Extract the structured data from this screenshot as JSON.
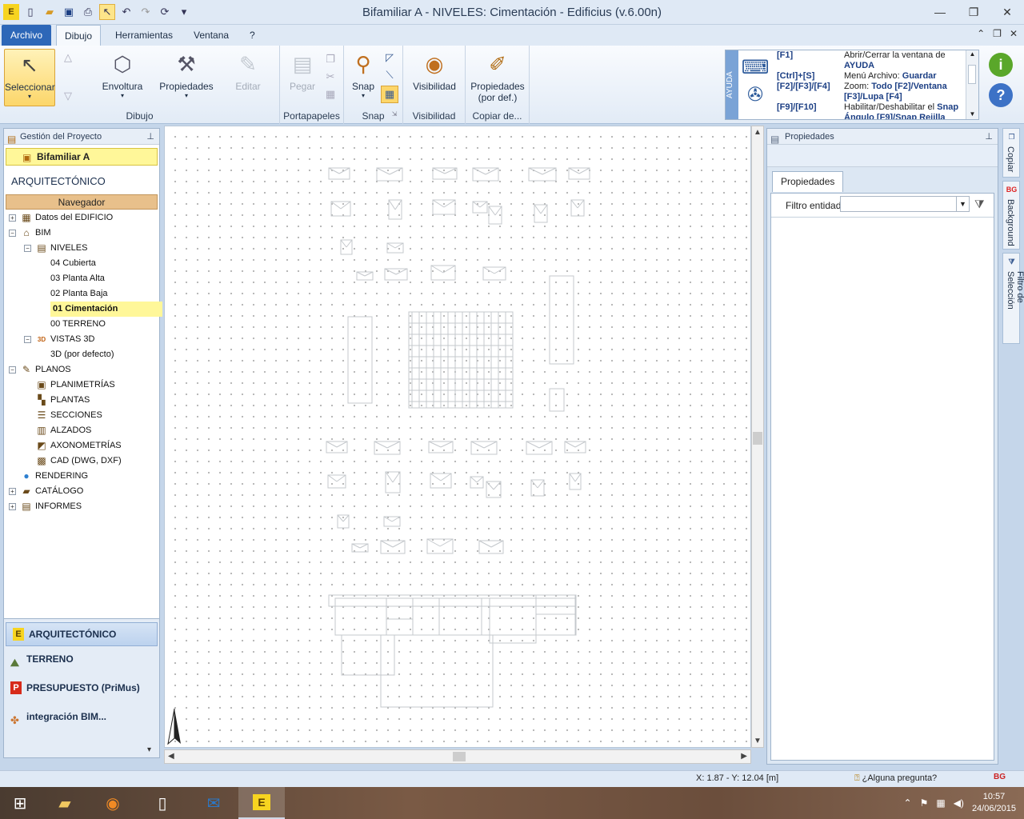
{
  "window": {
    "title": "Bifamiliar A -  NIVELES: Cimentación - Edificius (v.6.00n)"
  },
  "menu": {
    "tabs": [
      "Archivo",
      "Dibujo",
      "Herramientas",
      "Ventana",
      "?"
    ]
  },
  "ribbon": {
    "seleccionar": "Seleccionar",
    "envoltura": "Envoltura",
    "propiedades": "Propiedades",
    "editar": "Editar",
    "pegar": "Pegar",
    "snap": "Snap",
    "visibilidad": "Visibilidad",
    "propiedades_def_1": "Propiedades",
    "propiedades_def_2": "(por def.)",
    "groups": {
      "dibujo": "Dibujo",
      "portapapeles": "Portapapeles",
      "snap": "Snap",
      "visibilidad": "Visibilidad",
      "copiar": "Copiar de..."
    }
  },
  "help": {
    "label": "AYUDA",
    "rows": [
      {
        "key": "[F1]",
        "text": "Abrir/Cerrar la ventana de",
        "bold": "AYUDA"
      },
      {
        "key": "[Ctrl]+[S]",
        "text": "Menú Archivo:",
        "bold": "Guardar"
      },
      {
        "key": "[F2]/[F3]/[F4]",
        "text": "Zoom:",
        "bold": "Todo [F2]/Ventana [F3]/Lupa [F4]"
      },
      {
        "key": "[F9]/[F10]",
        "text": "Habilitar/Deshabilitar el",
        "bold": "Snap Ángulo [F9]/Snap Rejilla"
      }
    ]
  },
  "left_panel": {
    "header": "Gestión del Proyecto",
    "project": "Bifamiliar A",
    "section_title": "ARQUITECTÓNICO",
    "navigator": "Navegador",
    "tree": [
      {
        "label": "Datos del EDIFICIO",
        "level": 0,
        "exp": "+",
        "icon": "▦"
      },
      {
        "label": "BIM",
        "level": 0,
        "exp": "−",
        "icon": "⌂"
      },
      {
        "label": "NIVELES",
        "level": 1,
        "exp": "−",
        "icon": "▤"
      },
      {
        "label": "04 Cubierta",
        "level": 2
      },
      {
        "label": "03 Planta Alta",
        "level": 2
      },
      {
        "label": "02 Planta Baja",
        "level": 2
      },
      {
        "label": "01 Cimentación",
        "level": 2,
        "current": true
      },
      {
        "label": "00 TERRENO",
        "level": 2
      },
      {
        "label": "VISTAS 3D",
        "level": 1,
        "exp": "−",
        "icon": "3D"
      },
      {
        "label": "3D (por defecto)",
        "level": 2
      },
      {
        "label": "PLANOS",
        "level": 0,
        "exp": "−",
        "icon": "✎"
      },
      {
        "label": "PLANIMETRÍAS",
        "level": 1,
        "icon": "▣"
      },
      {
        "label": "PLANTAS",
        "level": 1,
        "icon": "▚"
      },
      {
        "label": "SECCIONES",
        "level": 1,
        "icon": "☰"
      },
      {
        "label": "ALZADOS",
        "level": 1,
        "icon": "▥"
      },
      {
        "label": "AXONOMETRÍAS",
        "level": 1,
        "icon": "◩"
      },
      {
        "label": "CAD (DWG, DXF)",
        "level": 1,
        "icon": "▩"
      },
      {
        "label": "RENDERING",
        "level": 0,
        "icon": "●"
      },
      {
        "label": "CATÁLOGO",
        "level": 0,
        "exp": "+",
        "icon": "▰"
      },
      {
        "label": "INFORMES",
        "level": 0,
        "exp": "+",
        "icon": "▤"
      }
    ],
    "modules": [
      "ARQUITECTÓNICO",
      "TERRENO",
      "PRESUPUESTO (PriMus)",
      "integración BIM..."
    ]
  },
  "right_panel": {
    "header": "Propiedades",
    "tab": "Propiedades",
    "filter_label": "Filtro entidad",
    "filter_value": ""
  },
  "side_tabs": [
    "Copiar",
    "Background",
    "Filtro de Selección"
  ],
  "status": {
    "coords": "X: 1.87 - Y: 12.04 [m]",
    "ask": "¿Alguna pregunta?"
  },
  "taskbar": {
    "time": "10:57",
    "date": "24/06/2015"
  },
  "colors": {
    "accent": "#2d67b8",
    "highlight": "#fff799",
    "navigator": "#e8c08b"
  }
}
